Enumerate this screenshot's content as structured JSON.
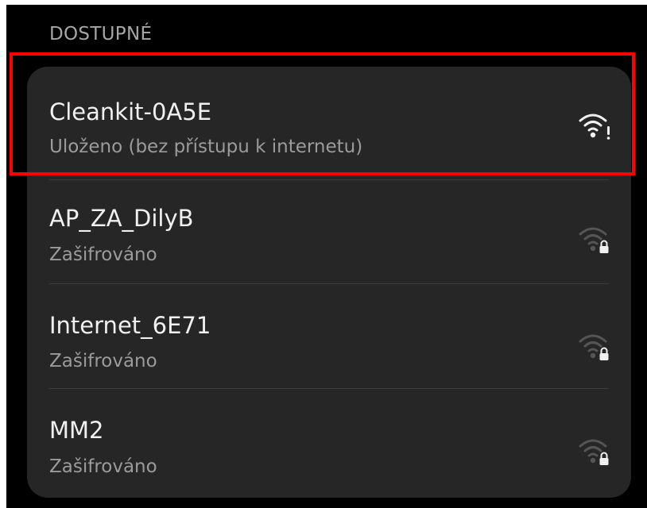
{
  "section": {
    "title": "DOSTUPNÉ"
  },
  "networks": [
    {
      "name": "Cleankit-0A5E",
      "status": "Uloženo (bez přístupu k internetu)",
      "icon": "wifi-no-internet-icon",
      "signal_strength": "full",
      "highlighted": true
    },
    {
      "name": "AP_ZA_DilyB",
      "status": "Zašifrováno",
      "icon": "wifi-locked-icon",
      "signal_strength": "weak",
      "highlighted": false
    },
    {
      "name": "Internet_6E71",
      "status": "Zašifrováno",
      "icon": "wifi-locked-icon",
      "signal_strength": "weak",
      "highlighted": false
    },
    {
      "name": "MM2",
      "status": "Zašifrováno",
      "icon": "wifi-locked-icon",
      "signal_strength": "weak",
      "highlighted": false
    }
  ],
  "colors": {
    "background": "#000000",
    "card": "#262626",
    "primary_text": "#f0f0f0",
    "secondary_text": "#9b9b9b",
    "highlight_border": "#ff0000"
  }
}
